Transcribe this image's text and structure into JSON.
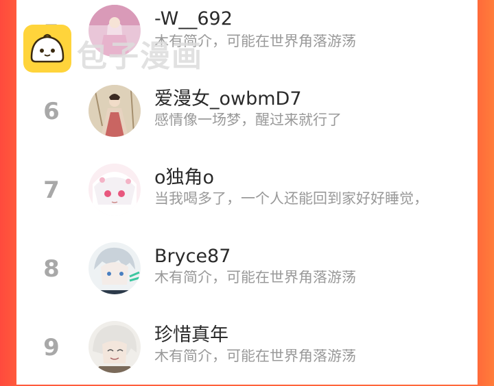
{
  "watermark": {
    "brand_text": "包子漫画",
    "logo_icon": "steamed-bun-icon"
  },
  "colors": {
    "background_gradient_start": "#ff4a3d",
    "background_gradient_end": "#ff7d3a",
    "rank_color": "#a8a8a8",
    "name_color": "#2a2a2a",
    "bio_color": "#999999",
    "logo_color": "#ffd43b"
  },
  "users": [
    {
      "rank": "5",
      "name": "-W__692",
      "bio": "木有简介，可能在世界角落游荡",
      "avatar": "pink-dress-character-avatar"
    },
    {
      "rank": "6",
      "name": "爱漫女_owbmD7",
      "bio": "感情像一场梦，醒过来就行了",
      "avatar": "ancient-costume-girl-avatar"
    },
    {
      "rank": "7",
      "name": "o独角o",
      "bio": "当我喝多了，一个人还能回到家好好睡觉，",
      "avatar": "white-hair-anime-girl-avatar"
    },
    {
      "rank": "8",
      "name": "Bryce87",
      "bio": "木有简介，可能在世界角落游荡",
      "avatar": "silver-hair-boy-avatar"
    },
    {
      "rank": "9",
      "name": "珍惜真年",
      "bio": "木有简介，可能在世界角落游荡",
      "avatar": "smiling-white-hair-avatar"
    }
  ]
}
